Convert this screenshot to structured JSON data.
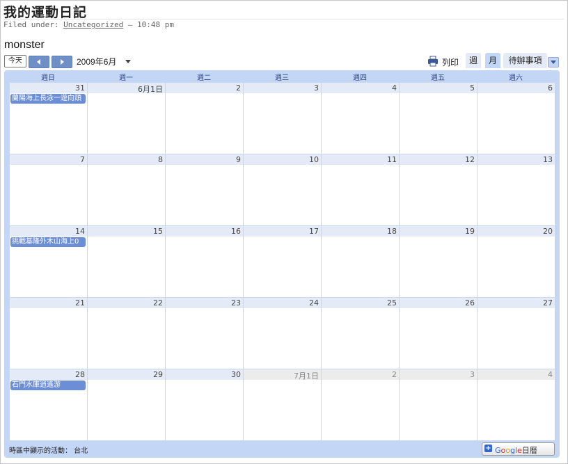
{
  "post": {
    "title": "我的運動日記",
    "meta_prefix": "Filed under: ",
    "category": "Uncategorized",
    "meta_suffix": " — 10:48 pm"
  },
  "calendar": {
    "name": "monster",
    "today_label": "今天",
    "month_label": "2009年6月",
    "print_label": "列印",
    "tabs": {
      "week": "週",
      "month": "月",
      "agenda": "待辦事項"
    },
    "weekdays": [
      "週日",
      "週一",
      "週二",
      "週三",
      "週四",
      "週五",
      "週六"
    ],
    "weeks": [
      {
        "days": [
          {
            "label": "31",
            "other": false
          },
          {
            "label": "6月1日",
            "other": false
          },
          {
            "label": "2",
            "other": false
          },
          {
            "label": "3",
            "other": false
          },
          {
            "label": "4",
            "other": false
          },
          {
            "label": "5",
            "other": false
          },
          {
            "label": "6",
            "other": false
          }
        ],
        "events": [
          {
            "day": 0,
            "title": "蘭陽海上長泳一遊向頭"
          }
        ]
      },
      {
        "days": [
          {
            "label": "7",
            "other": false
          },
          {
            "label": "8",
            "other": false
          },
          {
            "label": "9",
            "other": false
          },
          {
            "label": "10",
            "other": false
          },
          {
            "label": "11",
            "other": false
          },
          {
            "label": "12",
            "other": false
          },
          {
            "label": "13",
            "other": false
          }
        ],
        "events": []
      },
      {
        "days": [
          {
            "label": "14",
            "other": false
          },
          {
            "label": "15",
            "other": false
          },
          {
            "label": "16",
            "other": false
          },
          {
            "label": "17",
            "other": false
          },
          {
            "label": "18",
            "other": false
          },
          {
            "label": "19",
            "other": false
          },
          {
            "label": "20",
            "other": false
          }
        ],
        "events": [
          {
            "day": 0,
            "title": "挑戰基隆外木山海上0"
          }
        ]
      },
      {
        "days": [
          {
            "label": "21",
            "other": false
          },
          {
            "label": "22",
            "other": false
          },
          {
            "label": "23",
            "other": false
          },
          {
            "label": "24",
            "other": false
          },
          {
            "label": "25",
            "other": false
          },
          {
            "label": "26",
            "other": false
          },
          {
            "label": "27",
            "other": false
          }
        ],
        "events": []
      },
      {
        "days": [
          {
            "label": "28",
            "other": false
          },
          {
            "label": "29",
            "other": false
          },
          {
            "label": "30",
            "other": false
          },
          {
            "label": "7月1日",
            "other": true
          },
          {
            "label": "2",
            "other": true
          },
          {
            "label": "3",
            "other": true
          },
          {
            "label": "4",
            "other": true
          }
        ],
        "events": [
          {
            "day": 0,
            "title": "石門水庫逍遙游"
          }
        ]
      }
    ],
    "timezone_label": "時區中顯示的活動： 台北",
    "gcal_button": {
      "letters": [
        "G",
        "o",
        "o",
        "g",
        "l",
        "e"
      ],
      "suffix": "日曆"
    }
  },
  "colors": {
    "accent": "#c3d6f5",
    "event": "#6b8ed6",
    "header_blue": "#e4ebf6"
  }
}
